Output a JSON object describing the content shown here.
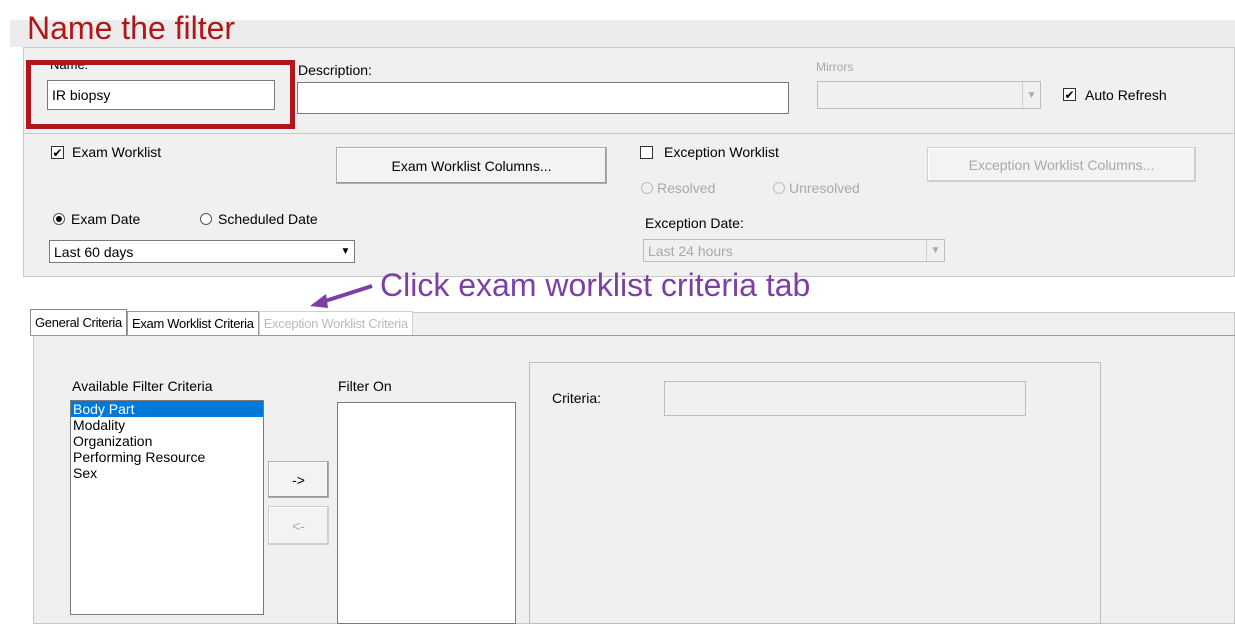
{
  "annotations": {
    "name_filter": "Name the filter",
    "click_tab": "Click exam worklist criteria tab"
  },
  "top": {
    "name_label": "Name:",
    "name_value": "IR biopsy",
    "description_label": "Description:",
    "description_value": "",
    "mirrors_label": "Mirrors",
    "auto_refresh_label": "Auto Refresh",
    "auto_refresh_checked": true
  },
  "worklist": {
    "exam_worklist_label": "Exam Worklist",
    "exam_worklist_checked": true,
    "exam_columns_button": "Exam Worklist Columns...",
    "exception_worklist_label": "Exception Worklist",
    "exception_worklist_checked": false,
    "exception_columns_button": "Exception Worklist Columns...",
    "resolved_label": "Resolved",
    "unresolved_label": "Unresolved",
    "exam_date_label": "Exam Date",
    "scheduled_date_label": "Scheduled Date",
    "exam_date_selected": true,
    "exam_range_value": "Last 60 days",
    "exception_date_label": "Exception Date:",
    "exception_range_value": "Last 24 hours"
  },
  "tabs": [
    {
      "label": "General Criteria",
      "selected": true,
      "enabled": true
    },
    {
      "label": "Exam Worklist Criteria",
      "selected": false,
      "enabled": true
    },
    {
      "label": "Exception Worklist Criteria",
      "selected": false,
      "enabled": false
    }
  ],
  "criteria": {
    "available_label": "Available Filter Criteria",
    "available_items": [
      "Body Part",
      "Modality",
      "Organization",
      "Performing Resource",
      "Sex"
    ],
    "selected_item": "Body Part",
    "filter_on_label": "Filter On",
    "add_button": "->",
    "remove_button": "<-",
    "criteria_label": "Criteria:"
  },
  "colors": {
    "annotation_red": "#b0171b",
    "annotation_purple": "#7b3fa6",
    "selection_blue": "#0078d7"
  }
}
